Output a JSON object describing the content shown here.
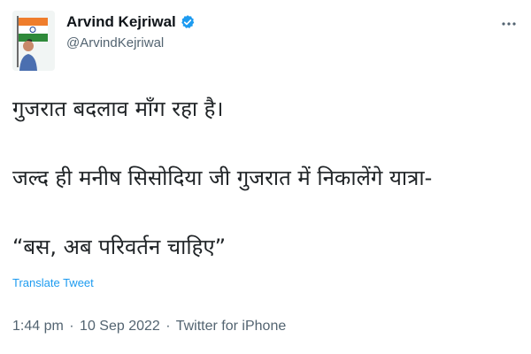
{
  "author": {
    "name": "Arvind Kejriwal",
    "handle": "@ArvindKejriwal",
    "verified": true
  },
  "icons": {
    "avatar": "profile-photo-with-indian-flag",
    "verified": "verified-badge-icon",
    "more": "more-options-icon"
  },
  "colors": {
    "link": "#1d9bf0",
    "secondary_text": "#536471",
    "primary_text": "#0f1419",
    "verified_badge": "#1d9bf0"
  },
  "tweet": {
    "lines": [
      "गुजरात बदलाव माँग रहा है।",
      "जल्द ही मनीष सिसोदिया जी गुजरात में निकालेंगे यात्रा-",
      "“बस, अब परिवर्तन चाहिए”"
    ],
    "translate_label": "Translate Tweet"
  },
  "meta": {
    "time": "1:44 pm",
    "separator": "·",
    "date": "10 Sep 2022",
    "source": "Twitter for iPhone"
  }
}
